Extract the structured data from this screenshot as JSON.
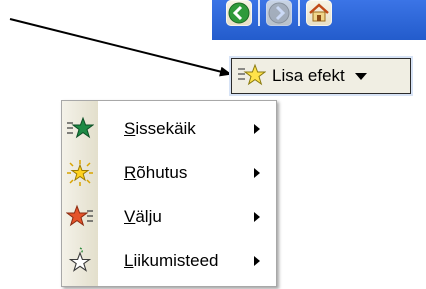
{
  "nav": {
    "buttons": [
      {
        "icon": "back-arrow-icon"
      },
      {
        "icon": "forward-arrow-icon"
      },
      {
        "icon": "home-icon"
      }
    ]
  },
  "add_effect_button": {
    "label": "Lisa efekt",
    "icon": "star-add-effect-icon"
  },
  "submenu": {
    "items": [
      {
        "hotkey": "S",
        "rest": "issekäik",
        "icon": "entrance-star-icon",
        "color": "#1a7a3a"
      },
      {
        "hotkey": "R",
        "rest": "õhutus",
        "icon": "emphasis-star-icon",
        "color": "#f2c200"
      },
      {
        "hotkey": "V",
        "rest": "älju",
        "icon": "exit-star-icon",
        "color": "#e2572a"
      },
      {
        "hotkey": "L",
        "rest": "iikumisteed",
        "icon": "motion-path-star-icon",
        "color": "#ffffff"
      }
    ]
  },
  "colors": {
    "nav_bar": "#2a62d6",
    "menu_gutter": "#ece9d8"
  }
}
